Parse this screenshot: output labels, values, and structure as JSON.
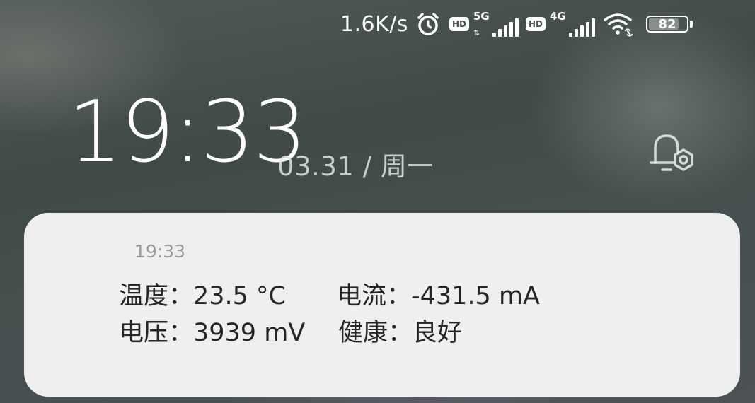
{
  "status_bar": {
    "net_speed": "1.6K/s",
    "icons": [
      "alarm-icon",
      "hd-badge-icon",
      "signal-5g-icon",
      "hd-badge-icon",
      "signal-4g-icon",
      "wifi-icon",
      "battery-icon"
    ],
    "hd_label": "HD",
    "sim1_type": "5G",
    "sim2_type": "4G",
    "sim1_arrows": "⇅",
    "battery_level": "82",
    "battery_fraction": 0.82
  },
  "lockscreen": {
    "time": "19:33",
    "date": "03.31 / 周一",
    "notification_settings_icon": "bell-gear-icon"
  },
  "notification": {
    "time": "19:33",
    "rows": [
      [
        "温度：23.5 °C",
        "电流：-431.5 mA"
      ],
      [
        "电压：3939 mV",
        "健康：良好"
      ]
    ]
  },
  "colors": {
    "card_background": "#efefef",
    "text_primary": "#262626",
    "text_secondary": "#9a9a9a",
    "foreground": "#ffffff"
  }
}
